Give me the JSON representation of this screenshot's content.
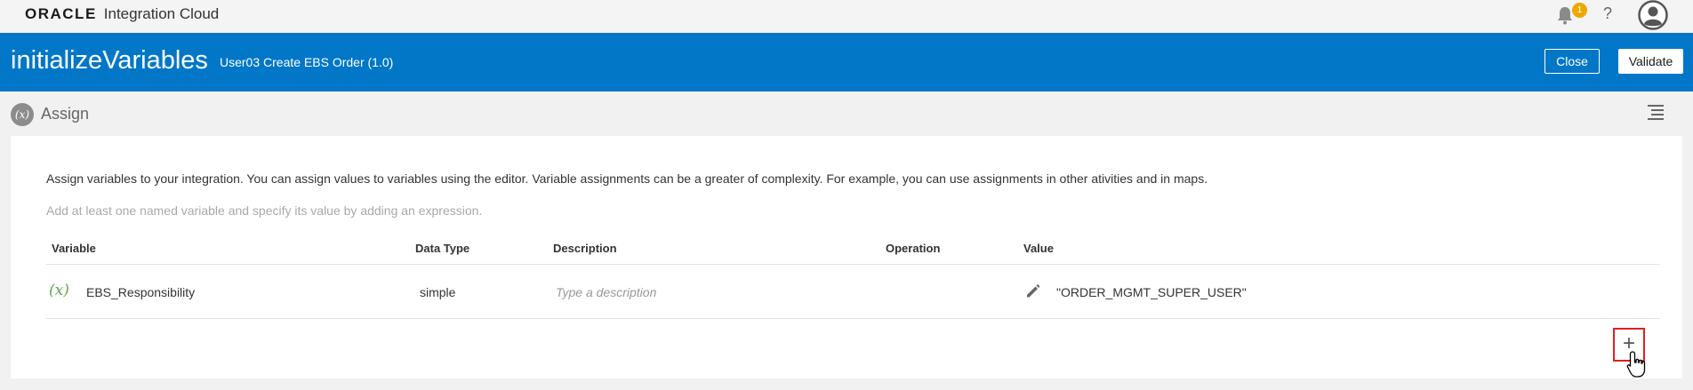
{
  "app": {
    "brand": "ORACLE",
    "product": "Integration Cloud",
    "notification_count": "1",
    "help_label": "?"
  },
  "header": {
    "title": "initializeVariables",
    "integration": "User03 Create EBS Order (1.0)",
    "close_label": "Close",
    "validate_label": "Validate",
    "background_color": "#0277c8"
  },
  "section": {
    "icon_text": "(x)",
    "title": "Assign"
  },
  "content": {
    "intro": "Assign variables to your integration. You can assign values to variables using the editor. Variable assignments can be a greater of complexity. For example, you can use assignments in other ativities and in maps.",
    "hint": "Add at least one named variable and specify its value by adding an expression."
  },
  "table": {
    "headers": {
      "variable": "Variable",
      "data_type": "Data Type",
      "description": "Description",
      "operation": "Operation",
      "value": "Value"
    },
    "rows": [
      {
        "icon_text": "(x)",
        "variable": "EBS_Responsibility",
        "data_type": "simple",
        "description_placeholder": "Type a description",
        "operation": "",
        "value": "\"ORDER_MGMT_SUPER_USER\""
      }
    ]
  },
  "actions": {
    "add_label": "+"
  },
  "icons": {
    "bell": "bell-icon",
    "help": "help-icon",
    "avatar": "user-avatar-icon",
    "menu": "list-menu-icon",
    "edit": "pencil-icon",
    "add": "plus-icon"
  },
  "colors": {
    "accent_blue": "#0277c8",
    "badge": "#f0a800",
    "variable_icon": "#5ba64a",
    "add_highlight": "#e02020"
  }
}
